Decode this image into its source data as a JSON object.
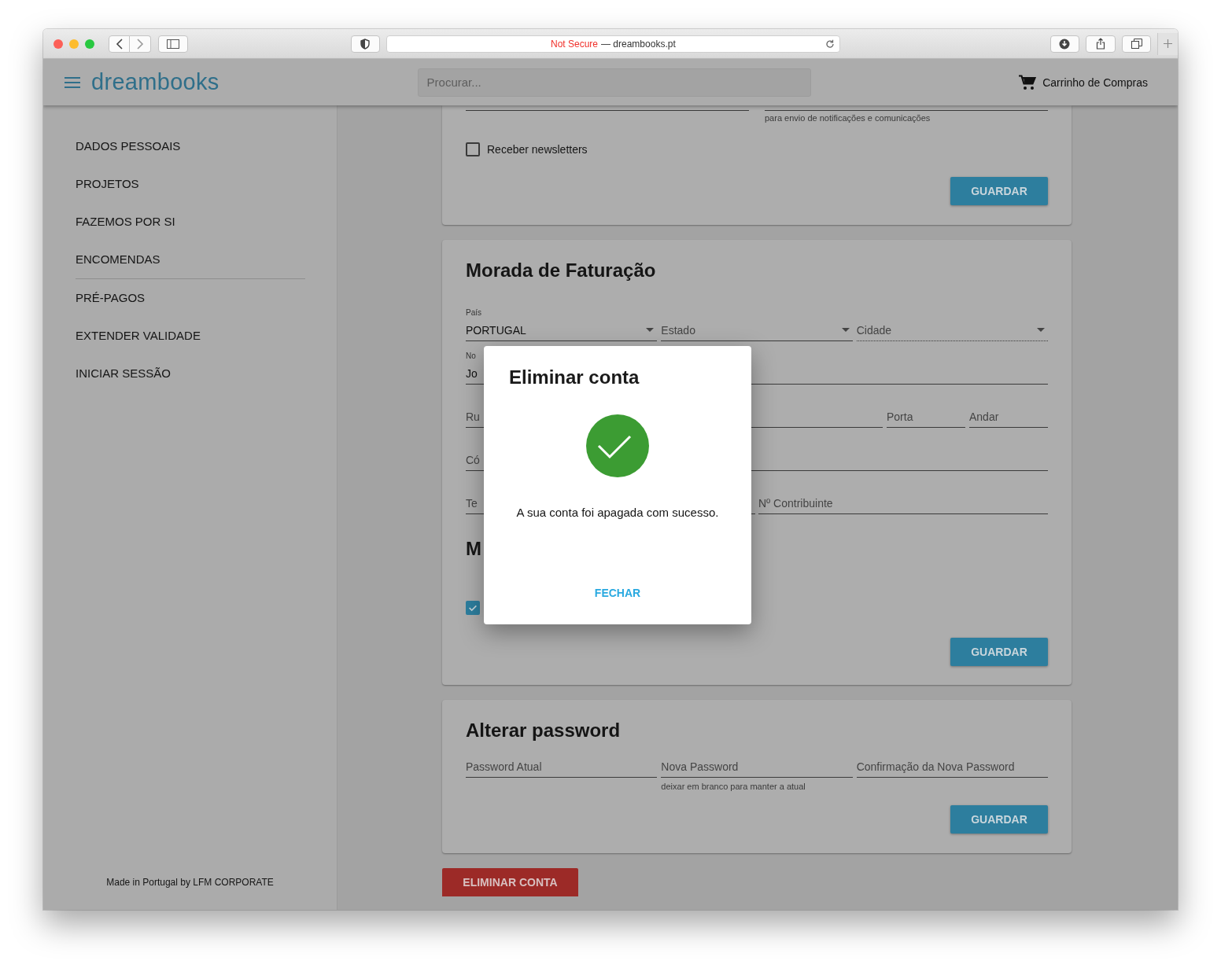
{
  "browser": {
    "security_label": "Not Secure",
    "url": "— dreambooks.pt"
  },
  "header": {
    "logo": "dreambooks",
    "search": {
      "placeholder": "Procurar..."
    },
    "cart_label": "Carrinho de Compras"
  },
  "sidebar": {
    "groups": [
      [
        {
          "label": "DADOS PESSOAIS"
        },
        {
          "label": "PROJETOS"
        },
        {
          "label": "FAZEMOS POR SI"
        },
        {
          "label": "ENCOMENDAS"
        }
      ],
      [
        {
          "label": "PRÉ-PAGOS"
        },
        {
          "label": "EXTENDER VALIDADE"
        },
        {
          "label": "INICIAR SESSÃO"
        }
      ]
    ],
    "footer": "Made in Portugal by LFM CORPORATE"
  },
  "contact_card": {
    "helper": "para envio de notificações e comunicações",
    "newsletter": {
      "label": "Receber newsletters",
      "checked": false
    },
    "button": "GUARDAR"
  },
  "billing_card": {
    "title": "Morada de Faturação",
    "rows": [
      [
        {
          "kind": "select",
          "label": "País",
          "value": "PORTUGAL",
          "disabled": false
        },
        {
          "kind": "select",
          "placeholder": "Estado",
          "disabled": false
        },
        {
          "kind": "select",
          "placeholder": "Cidade",
          "disabled": true
        }
      ],
      [
        {
          "kind": "text",
          "label": "No",
          "value": "Jo"
        }
      ],
      [
        {
          "kind": "text",
          "placeholder": "Ru"
        },
        {
          "kind": "text",
          "placeholder": "Porta"
        },
        {
          "kind": "text",
          "placeholder": "Andar"
        }
      ],
      [
        {
          "kind": "text",
          "placeholder": "Có"
        }
      ],
      [
        {
          "kind": "text",
          "placeholder": "Te"
        },
        {
          "kind": "text",
          "placeholder": "Nº Contribuinte"
        }
      ]
    ],
    "second_title": "M",
    "same_address": {
      "checked": true
    },
    "button": "GUARDAR"
  },
  "password_card": {
    "title": "Alterar password",
    "fields": [
      {
        "placeholder": "Password Atual"
      },
      {
        "placeholder": "Nova Password",
        "helper": "deixar em branco para manter a atual"
      },
      {
        "placeholder": "Confirmação da Nova Password"
      }
    ],
    "button": "GUARDAR"
  },
  "delete_button": "ELIMINAR CONTA",
  "dialog": {
    "title": "Eliminar conta",
    "message": "A sua conta foi apagada com sucesso.",
    "button": "FECHAR"
  }
}
